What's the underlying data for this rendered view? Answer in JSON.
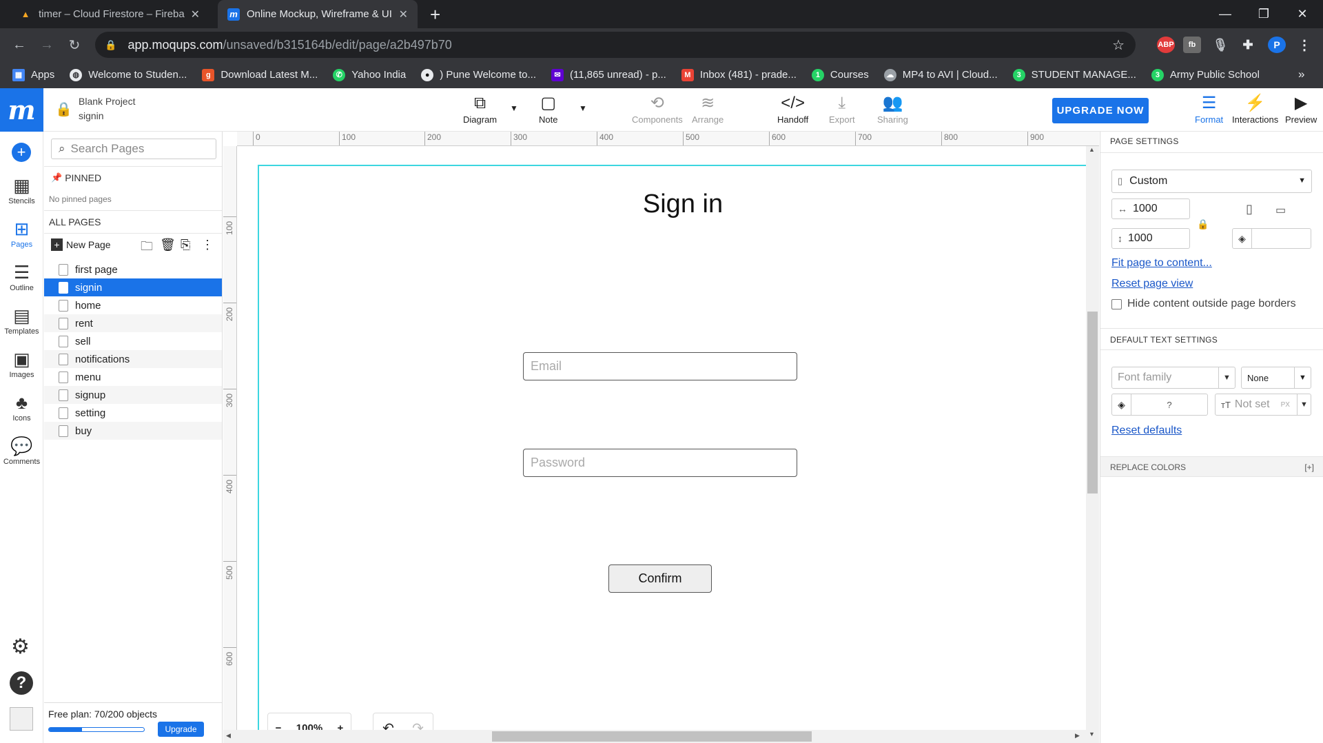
{
  "browser": {
    "tabs": [
      {
        "title": "timer – Cloud Firestore – Fireba:",
        "icon": "firebase-icon"
      },
      {
        "title": "Online Mockup, Wireframe & UI",
        "icon": "moqups-icon"
      }
    ],
    "new_tab": "+",
    "url_host": "app.moqups.com",
    "url_path": "/unsaved/b315164b/edit/page/a2b497b70",
    "profile_initial": "P",
    "bookmarks": [
      {
        "label": "Apps",
        "icon": "apps-grid-icon"
      },
      {
        "label": "Welcome to Studen...",
        "icon": "globe-icon"
      },
      {
        "label": "Download Latest M...",
        "icon": "g-icon"
      },
      {
        "label": "Yahoo India",
        "icon": "whatsapp-icon"
      },
      {
        "label": ") Pune Welcome to...",
        "icon": "github-icon"
      },
      {
        "label": "(11,865 unread) - p...",
        "icon": "yahoo-mail-icon"
      },
      {
        "label": "Inbox (481) - prade...",
        "icon": "gmail-icon"
      },
      {
        "label": "Courses",
        "icon": "whatsapp-icon"
      },
      {
        "label": "MP4 to AVI | Cloud...",
        "icon": "cloud-icon"
      },
      {
        "label": "STUDENT MANAGE...",
        "icon": "whatsapp-icon"
      },
      {
        "label": "Army Public School",
        "icon": "whatsapp-icon"
      }
    ],
    "bookmarks_more": "»"
  },
  "app": {
    "project_name": "Blank Project",
    "page_name": "signin",
    "toolbar": [
      {
        "label": "Diagram",
        "icon": "diagram-icon"
      },
      {
        "label": "Note",
        "icon": "note-icon"
      },
      {
        "label": "Components",
        "icon": "components-icon"
      },
      {
        "label": "Arrange",
        "icon": "arrange-icon"
      },
      {
        "label": "Handoff",
        "icon": "handoff-icon"
      },
      {
        "label": "Export",
        "icon": "export-icon"
      },
      {
        "label": "Sharing",
        "icon": "sharing-icon"
      }
    ],
    "upgrade_label": "UPGRADE NOW",
    "right_tools": [
      {
        "label": "Format",
        "icon": "format-icon"
      },
      {
        "label": "Interactions",
        "icon": "interactions-icon"
      },
      {
        "label": "Preview",
        "icon": "preview-icon"
      }
    ]
  },
  "rail": [
    {
      "label": "Stencils",
      "icon": "stencils-icon"
    },
    {
      "label": "Pages",
      "icon": "pages-icon"
    },
    {
      "label": "Outline",
      "icon": "outline-icon"
    },
    {
      "label": "Templates",
      "icon": "templates-icon"
    },
    {
      "label": "Images",
      "icon": "images-icon"
    },
    {
      "label": "Icons",
      "icon": "icons-icon"
    },
    {
      "label": "Comments",
      "icon": "comments-icon"
    }
  ],
  "pages_panel": {
    "search_placeholder": "Search Pages",
    "pinned_label": "PINNED",
    "no_pinned": "No pinned pages",
    "all_pages_label": "ALL PAGES",
    "new_page": "New Page",
    "pages": [
      "first page",
      "signin",
      "home",
      "rent",
      "sell",
      "notifications",
      "menu",
      "signup",
      "setting",
      "buy"
    ],
    "selected": "signin",
    "plan_text": "Free plan: 70/200 objects",
    "plan_used_fraction": 0.35,
    "upgrade_label": "Upgrade"
  },
  "canvas": {
    "ruler_h": [
      "0",
      "100",
      "200",
      "300",
      "400",
      "500",
      "600",
      "700",
      "800",
      "900"
    ],
    "ruler_v": [
      "100",
      "200",
      "300",
      "400",
      "500",
      "600"
    ],
    "title": "Sign in",
    "email_placeholder": "Email",
    "password_placeholder": "Password",
    "confirm_label": "Confirm",
    "zoom": "100%",
    "zoom_minus": "−",
    "zoom_plus": "+"
  },
  "right_panel": {
    "page_settings_label": "PAGE SETTINGS",
    "size_preset": "Custom",
    "width": "1000",
    "height": "1000",
    "fit_page": "Fit page to content...",
    "reset_view": "Reset page view",
    "hide_outside": "Hide content outside page borders",
    "default_text_label": "DEFAULT TEXT SETTINGS",
    "font_family_placeholder": "Font family",
    "font_style": "None",
    "color_value": "?",
    "size_placeholder": "Not set",
    "size_unit": "PX",
    "reset_defaults": "Reset defaults",
    "replace_colors_label": "REPLACE COLORS",
    "replace_colors_toggle": "[+]"
  },
  "colors": {
    "accent": "#1a73e8",
    "page_border": "#3cd6e0"
  }
}
